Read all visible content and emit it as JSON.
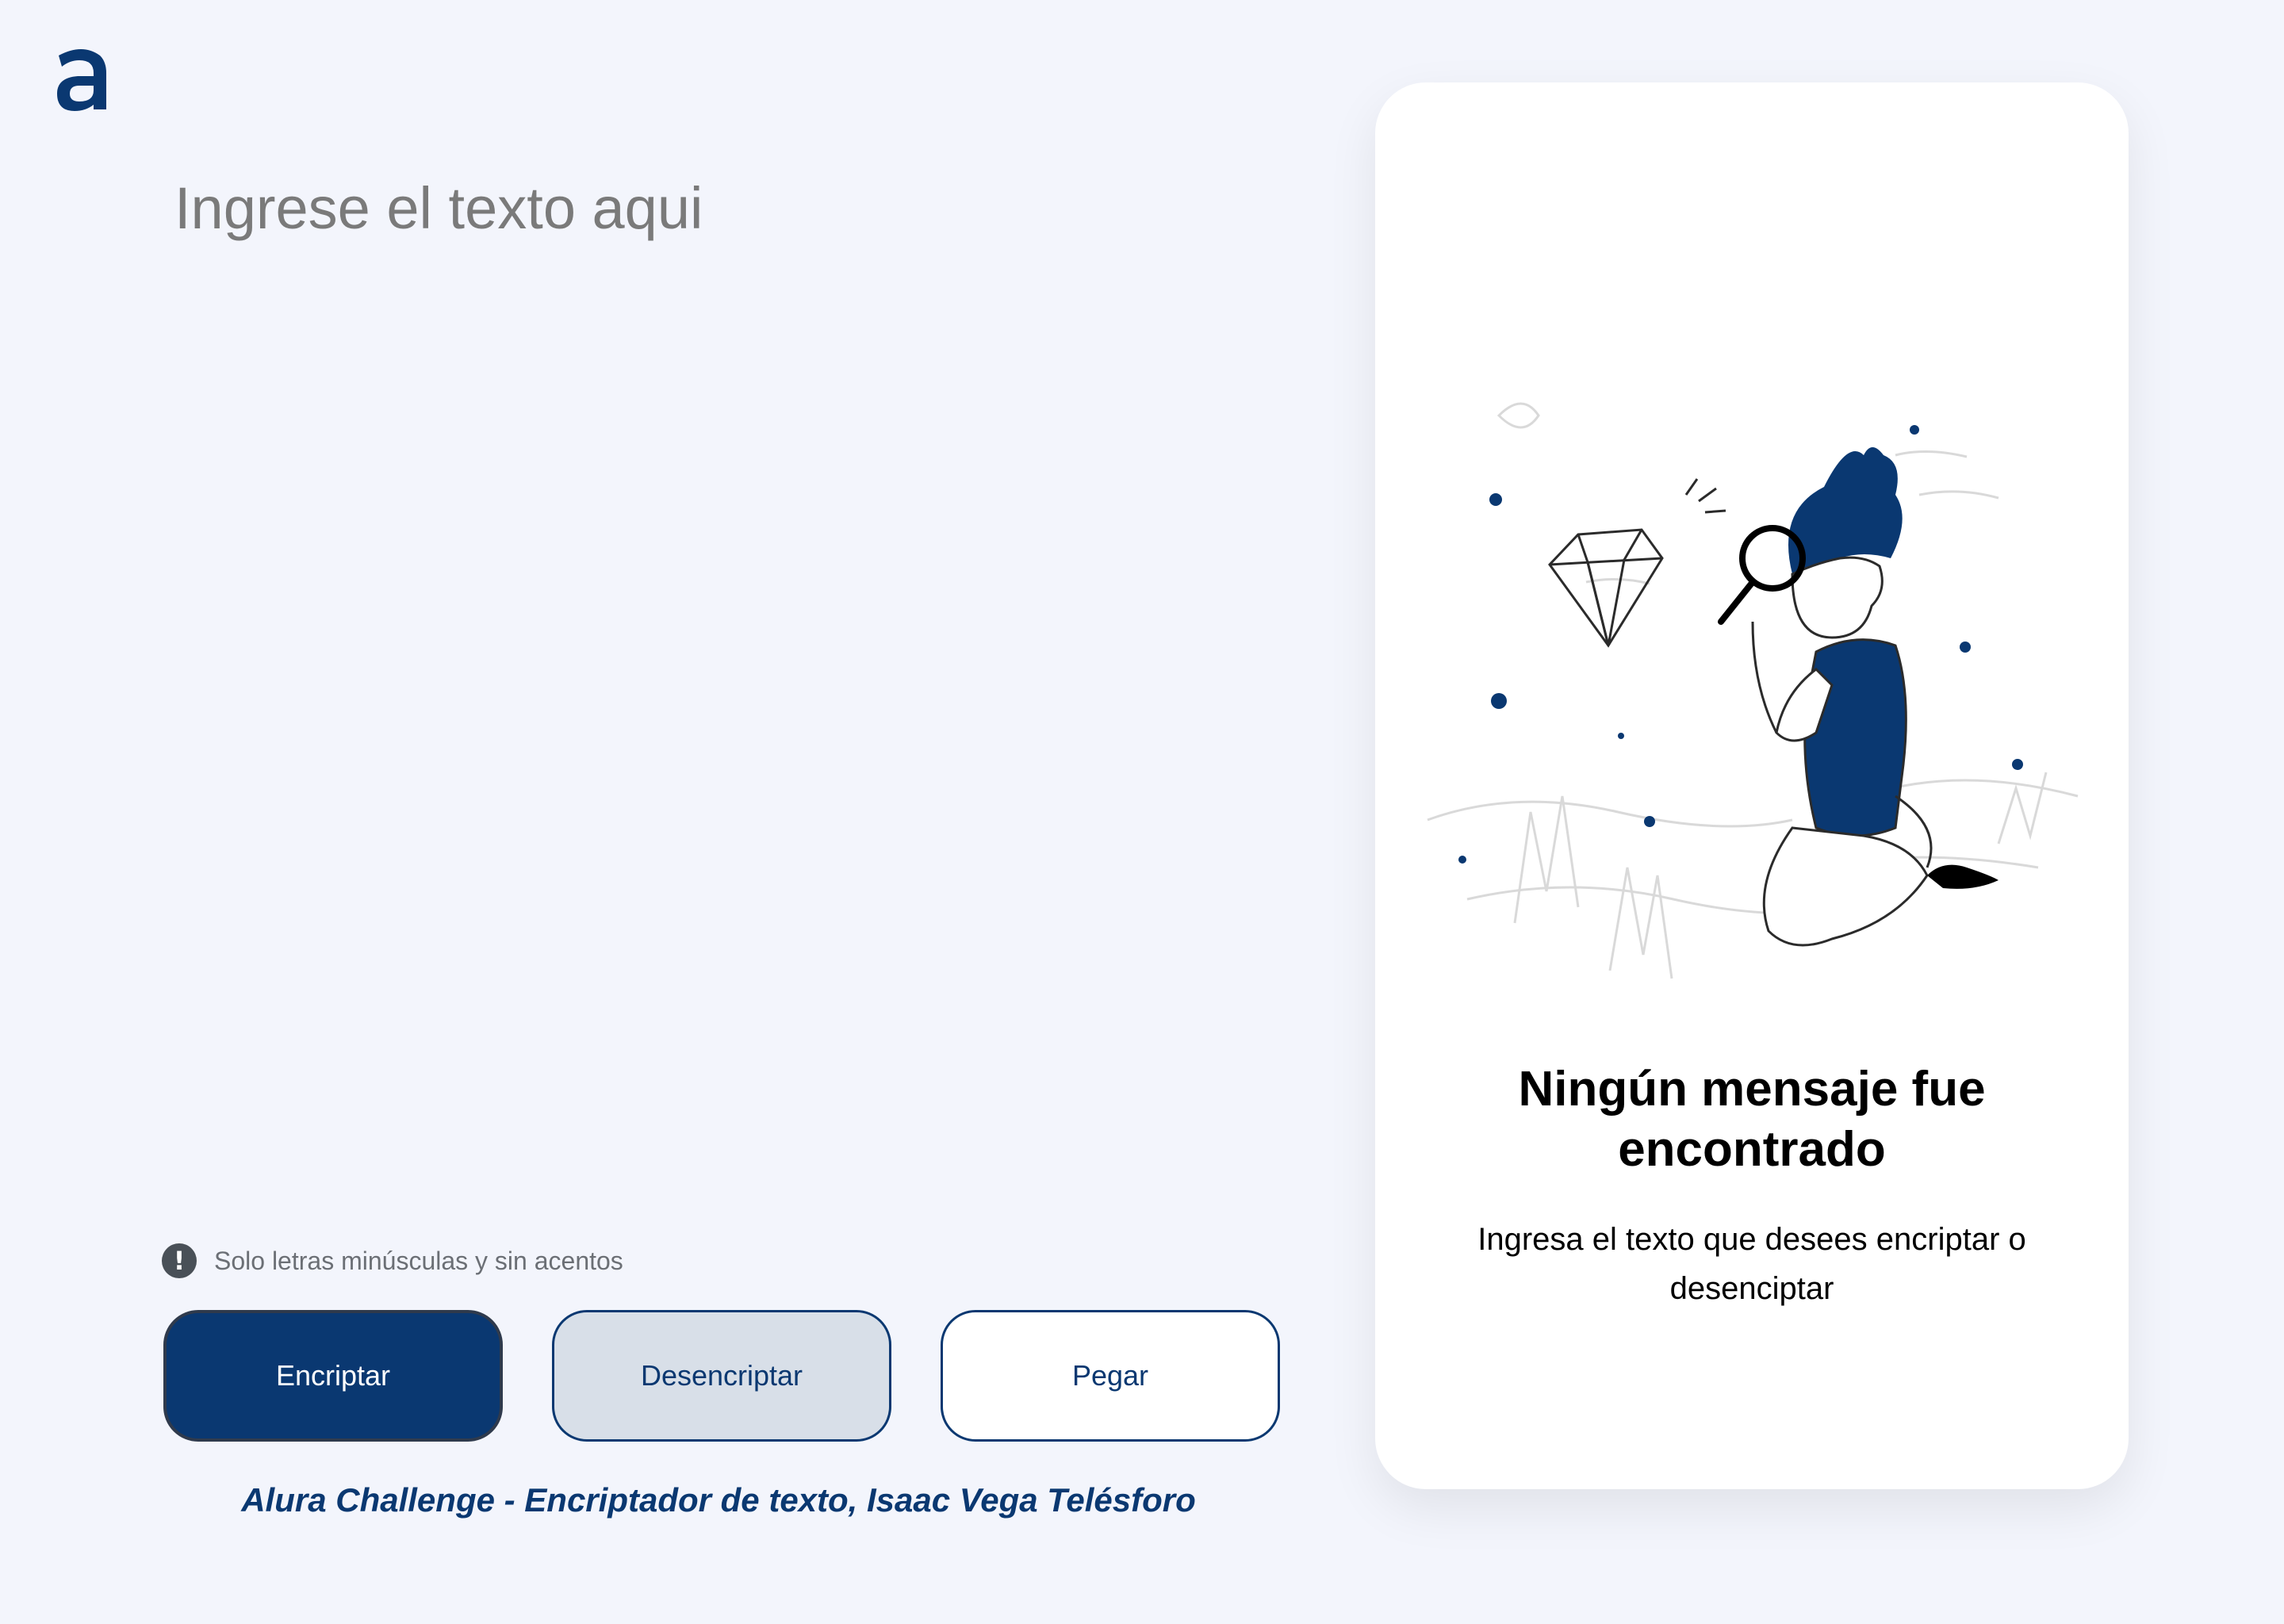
{
  "brand": {
    "logo_icon": "alura-a-logo-icon",
    "accent_color": "#0A3871",
    "background_color": "#F3F5FC"
  },
  "editor": {
    "placeholder": "Ingrese el texto aqui",
    "value": ""
  },
  "hint": {
    "icon": "exclamation-circle-icon",
    "text": "Solo letras minúsculas y sin acentos"
  },
  "buttons": {
    "encrypt_label": "Encriptar",
    "decrypt_label": "Desencriptar",
    "paste_label": "Pegar"
  },
  "footer": {
    "text": "Alura Challenge - Encriptador de texto, Isaac Vega Telésforo"
  },
  "output": {
    "illustration_icon": "person-with-magnifying-glass-illustration",
    "title": "Ningún mensaje fue encontrado",
    "message": "Ingresa el texto que desees encriptar o desenciptar"
  }
}
